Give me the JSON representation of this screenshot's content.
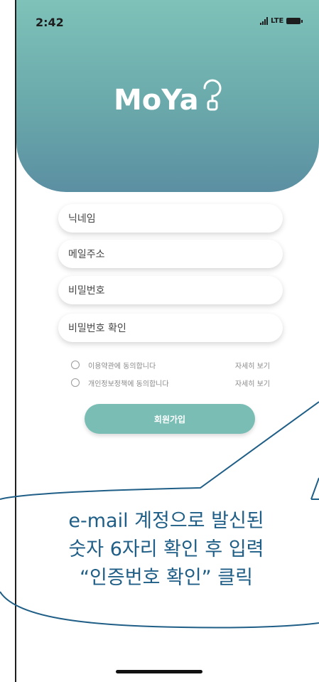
{
  "status_bar": {
    "time": "2:42",
    "network": "LTE",
    "icons": [
      "signal-icon",
      "battery-icon"
    ]
  },
  "logo": {
    "text": "MoYa",
    "icon": "lightbulb-icon"
  },
  "form": {
    "nickname_placeholder": "닉네임",
    "email_placeholder": "메일주소",
    "password_placeholder": "비밀번호",
    "password_confirm_placeholder": "비밀번호 확인"
  },
  "agreements": [
    {
      "label": "이용약관에 동의합니다",
      "link": "자세히 보기"
    },
    {
      "label": "개인정보정책에 동의합니다",
      "link": "자세히 보기"
    }
  ],
  "signup_button": "회원가입",
  "callout": {
    "line1": "e-mail 계정으로 발신된",
    "line2": "숫자 6자리 확인 후 입력",
    "line3": "“인증번호 확인” 클릭"
  },
  "colors": {
    "accent": "#79bdb5",
    "header_top": "#7ec2b9",
    "header_bottom": "#5b8fa2",
    "callout_text": "#1f5e86"
  }
}
